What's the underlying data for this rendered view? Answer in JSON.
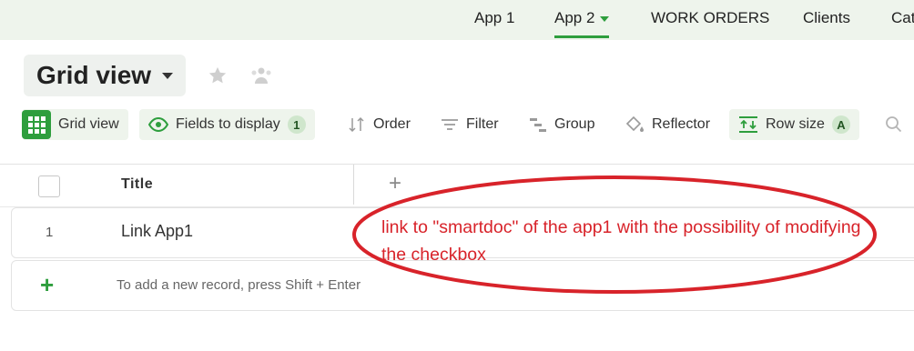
{
  "topnav": {
    "tabs": [
      {
        "label": "App 1"
      },
      {
        "label": "App 2"
      },
      {
        "label": "WORK ORDERS"
      },
      {
        "label": "Clients"
      },
      {
        "label": "Cat"
      }
    ]
  },
  "view": {
    "title": "Grid view"
  },
  "toolbar": {
    "grid_view": "Grid view",
    "fields_to_display": "Fields to display",
    "fields_count": "1",
    "order": "Order",
    "filter": "Filter",
    "group": "Group",
    "reflector": "Reflector",
    "row_size": "Row size",
    "row_size_value": "A"
  },
  "grid": {
    "columns": [
      "Title"
    ],
    "add_column": "+",
    "rows": [
      {
        "number": "1",
        "title": "Link App1"
      }
    ],
    "add_row_icon": "+",
    "add_row_hint": "To add a new record, press Shift + Enter"
  },
  "annotation": {
    "text": "link to \"smartdoc\" of the app1 with the possibility of modifying the checkbox",
    "color": "#d8232a"
  },
  "colors": {
    "accent": "#2e9e3d",
    "nav_bg": "#eef4ec"
  }
}
